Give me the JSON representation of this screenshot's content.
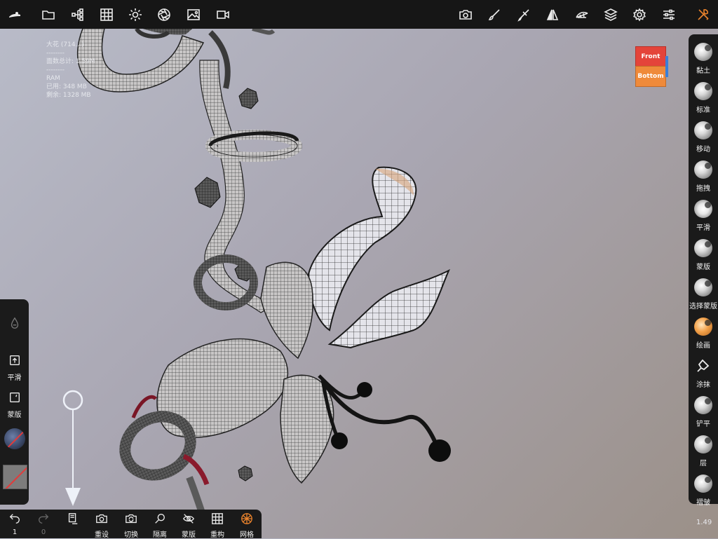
{
  "top_toolbar": {
    "left_icons": [
      "logo-icon",
      "folder-icon",
      "scene-tree-icon",
      "grid-icon",
      "sun-icon",
      "aperture-icon",
      "image-icon",
      "video-icon"
    ],
    "right_icons": [
      "camera-icon",
      "brush-icon",
      "paint-roller-icon",
      "symmetry-icon",
      "topology-icon",
      "layers-icon",
      "gear-icon",
      "sliders-icon",
      "tools-icon"
    ]
  },
  "info_overlay": {
    "line1": "大花 (714...)",
    "sep1": "--------",
    "line2": "面数总计: 1.59M",
    "sep2": "--------",
    "ram_label": "RAM",
    "used": "已用:  348 MB",
    "free": "剩余:  1328 MB"
  },
  "view_cube": {
    "top": "Front",
    "bottom": "Bottom"
  },
  "right_tools": [
    {
      "label": "黏土",
      "kind": "sphere"
    },
    {
      "label": "标准",
      "kind": "sphere"
    },
    {
      "label": "移动",
      "kind": "sphere"
    },
    {
      "label": "拖拽",
      "kind": "sphere"
    },
    {
      "label": "平滑",
      "kind": "smooth"
    },
    {
      "label": "蒙版",
      "kind": "sphere"
    },
    {
      "label": "选择蒙版",
      "kind": "sphere"
    },
    {
      "label": "绘画",
      "kind": "paint"
    },
    {
      "label": "涂抹",
      "kind": "smear"
    },
    {
      "label": "铲平",
      "kind": "sphere"
    },
    {
      "label": "层",
      "kind": "sphere"
    },
    {
      "label": "褶皱",
      "kind": "sphere"
    }
  ],
  "left_panel": {
    "smooth_label": "平滑",
    "mask_label": "蒙版"
  },
  "bottom_toolbar": {
    "undo_count": "1",
    "redo_count": "0",
    "reset_label": "重设",
    "switch_label": "切换",
    "isolate_label": "隔离",
    "mask_label": "蒙版",
    "remesh_label": "重构",
    "wireframe_label": "网格"
  },
  "colors": {
    "accent_orange": "#e8822c",
    "toolbar_bg": "#161616",
    "panel_bg": "#1a1a1a"
  },
  "version": "1.49"
}
